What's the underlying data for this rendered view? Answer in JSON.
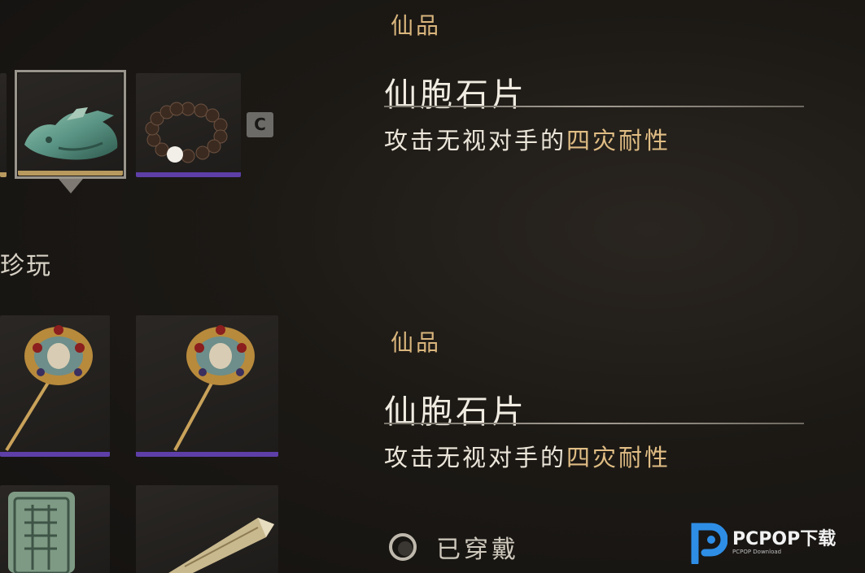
{
  "equipped_row": {
    "key_hint": "C"
  },
  "section": {
    "label": "珍玩"
  },
  "detail_top": {
    "tier": "仙品",
    "name": "仙胞石片",
    "desc_prefix": "攻击无视对手的",
    "desc_highlight": "四灾耐性"
  },
  "detail_bottom": {
    "tier": "仙品",
    "name": "仙胞石片",
    "desc_prefix": "攻击无视对手的",
    "desc_highlight": "四灾耐性"
  },
  "status": {
    "equipped_label": "已穿戴"
  },
  "watermark": {
    "brand": "PCPOP下载",
    "sub": "PCPOP Download"
  },
  "colors": {
    "rarity_purple": "#5e3fa8",
    "rarity_gold": "#b99a5e",
    "highlight": "#e0bd84",
    "tier_text": "#d9b57c"
  }
}
